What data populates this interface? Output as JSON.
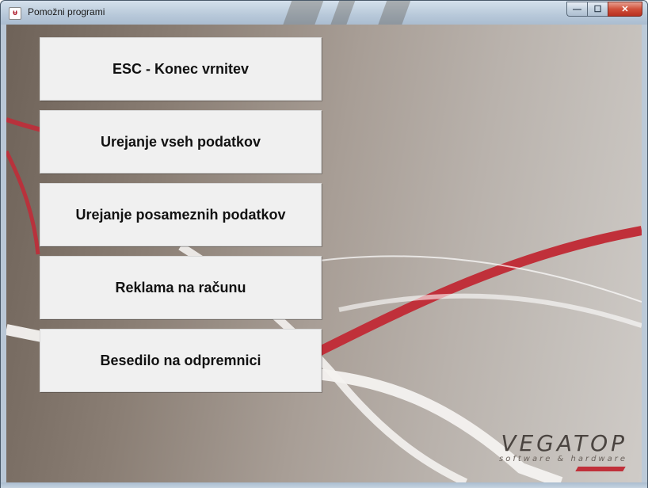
{
  "window": {
    "title": "Pomožni programi",
    "app_icon": "vegatop-app-icon",
    "controls": {
      "minimize": "—",
      "maximize": "☐",
      "close": "✕"
    }
  },
  "menu": {
    "buttons": [
      {
        "label": "ESC - Konec vrnitev"
      },
      {
        "label": "Urejanje vseh podatkov"
      },
      {
        "label": "Urejanje posameznih podatkov"
      },
      {
        "label": "Reklama na računu"
      },
      {
        "label": "Besedilo na odpremnici"
      }
    ]
  },
  "logo": {
    "name": "VEGATOP",
    "tagline": "software & hardware"
  },
  "colors": {
    "accent_red": "#c0303a",
    "button_face": "#f0f0f0"
  }
}
